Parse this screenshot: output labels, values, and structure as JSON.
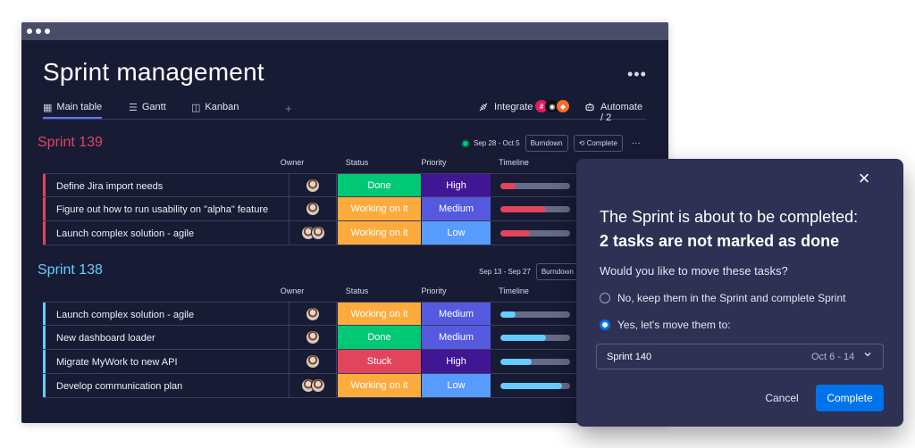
{
  "window": {
    "title": "Sprint management",
    "more_icon": "more-horizontal-icon"
  },
  "tabs": [
    {
      "label": "Main table",
      "icon": "table-icon",
      "glyph": "▦"
    },
    {
      "label": "Gantt",
      "icon": "gantt-icon",
      "glyph": "☰"
    },
    {
      "label": "Kanban",
      "icon": "kanban-icon",
      "glyph": "◫"
    }
  ],
  "tab_add": "+",
  "integrate": {
    "label": "Integrate",
    "icon": "integrate-icon"
  },
  "automate": {
    "label": "Automate / 2",
    "icon": "robot-icon"
  },
  "columns": {
    "owner": "Owner",
    "status": "Status",
    "priority": "Priority",
    "timeline": "Timeline"
  },
  "sprint139": {
    "title": "Sprint 139",
    "color": "#e2445c",
    "dates": "Sep 28 - Oct 5",
    "burndown": "Burndown",
    "complete": "Complete",
    "more": "···",
    "rows": [
      {
        "name": "Define Jira import needs",
        "status": "Done",
        "status_color": "#00c875",
        "priority": "High",
        "priority_color": "#401694",
        "progress": 0.22,
        "bar_color": "#e2445c"
      },
      {
        "name": "Figure out how to run usability on \"alpha\" feature",
        "status": "Working on it",
        "status_color": "#fdab3d",
        "priority": "Medium",
        "priority_color": "#5559df",
        "progress": 0.65,
        "bar_color": "#e2445c"
      },
      {
        "name": "Launch complex solution - agile",
        "status": "Working on it",
        "status_color": "#fdab3d",
        "priority": "Low",
        "priority_color": "#579bfc",
        "progress": 0.42,
        "bar_color": "#e2445c"
      }
    ]
  },
  "sprint138": {
    "title": "Sprint 138",
    "color": "#66ccff",
    "dates": "Sep 13 - Sep 27",
    "burndown": "Burndown",
    "rows": [
      {
        "name": "Launch complex solution - agile",
        "status": "Working on it",
        "status_color": "#fdab3d",
        "priority": "Medium",
        "priority_color": "#5559df",
        "progress": 0.22,
        "bar_color": "#66ccff"
      },
      {
        "name": "New dashboard loader",
        "status": "Done",
        "status_color": "#00c875",
        "priority": "Medium",
        "priority_color": "#5559df",
        "progress": 0.65,
        "bar_color": "#66ccff"
      },
      {
        "name": "Migrate MyWork to new API",
        "status": "Stuck",
        "status_color": "#e2445c",
        "priority": "High",
        "priority_color": "#401694",
        "progress": 0.45,
        "bar_color": "#66ccff"
      },
      {
        "name": "Develop communication plan",
        "status": "Working on it",
        "status_color": "#fdab3d",
        "priority": "Low",
        "priority_color": "#579bfc",
        "progress": 0.88,
        "bar_color": "#66ccff"
      }
    ]
  },
  "modal": {
    "close": "×",
    "headline": "The Sprint is about to be completed:",
    "headline_bold": "2 tasks are not marked as done",
    "question": "Would you like to move these tasks?",
    "option_keep": "No, keep them in the Sprint and complete Sprint",
    "option_move": "Yes, let's move them to:",
    "selected_option": "move",
    "select_value": "Sprint 140",
    "select_dates": "Oct 6 - 14",
    "cancel": "Cancel",
    "complete": "Complete",
    "accent": "#0073ea"
  }
}
